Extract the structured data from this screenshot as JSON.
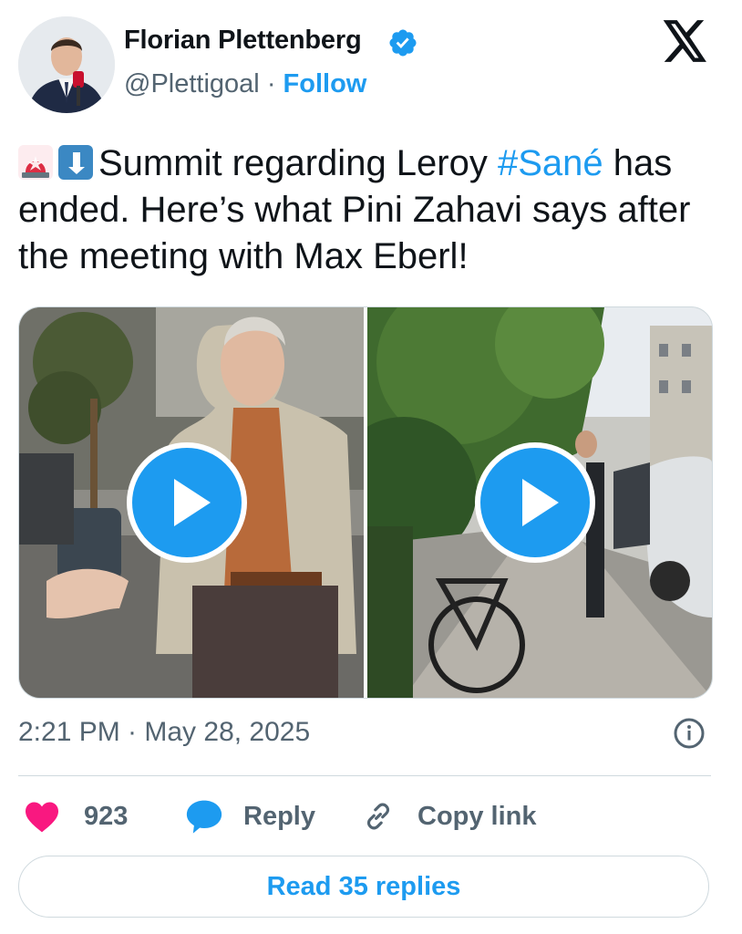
{
  "author": {
    "name": "Florian Plettenberg",
    "handle": "@Plettigoal",
    "separator": "·",
    "follow_label": "Follow"
  },
  "tweet": {
    "text_intro": "Summit regarding Leroy ",
    "hashtag": "#Sané",
    "text_rest": " has ended. Here’s what Pini Zahavi says after the meeting with Max Eberl!"
  },
  "media": {
    "videos": [
      {
        "id": "left",
        "icon": "play-icon"
      },
      {
        "id": "right",
        "icon": "play-icon"
      }
    ]
  },
  "timestamp": "2:21 PM · May 28, 2025",
  "actions": {
    "likes_count": "923",
    "reply_label": "Reply",
    "copy_link_label": "Copy link"
  },
  "read_replies_label": "Read 35 replies",
  "colors": {
    "accent": "#1d9bf0",
    "like": "#f91880",
    "text_primary": "#0f1419",
    "text_secondary": "#536471",
    "border": "#cfd9de"
  },
  "icons": [
    "x-logo-icon",
    "verified-badge-icon",
    "siren-emoji",
    "arrow-down-right-emoji",
    "play-icon",
    "info-icon",
    "heart-icon",
    "speech-bubble-icon",
    "link-icon"
  ]
}
